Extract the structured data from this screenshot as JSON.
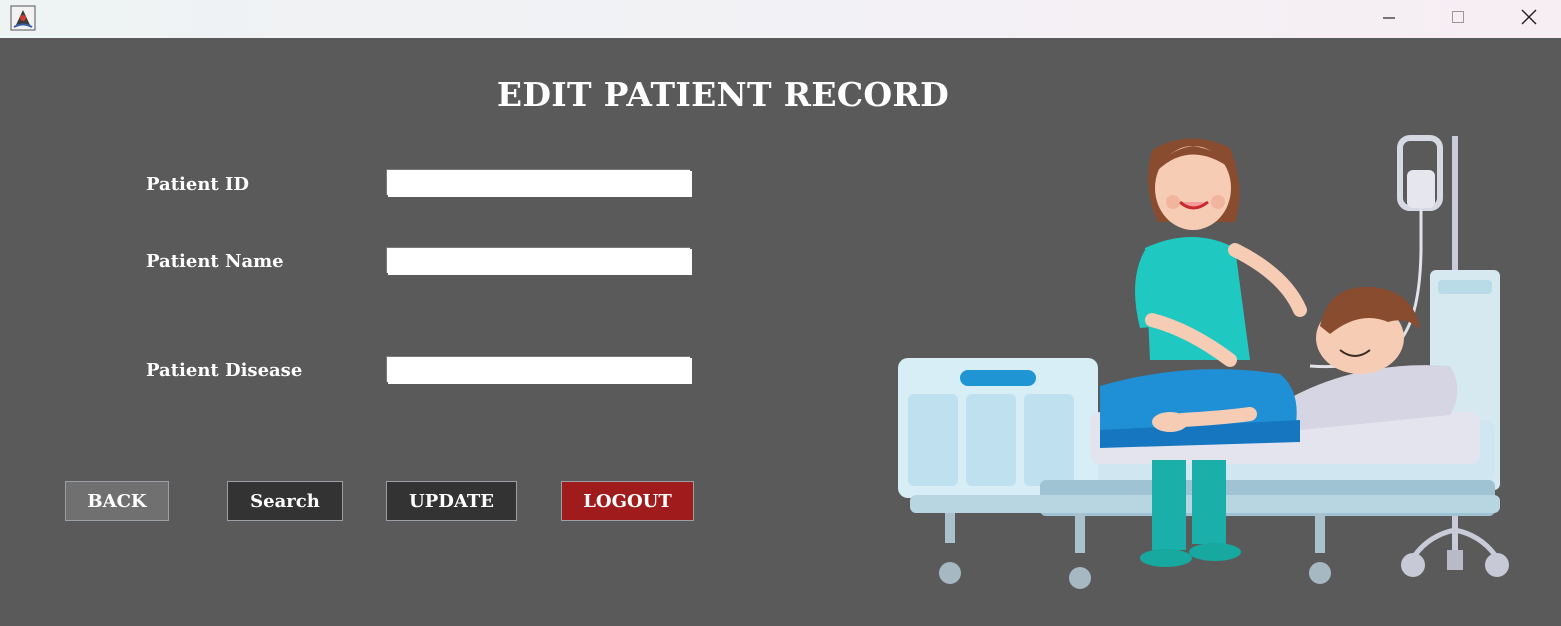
{
  "window": {
    "app_icon": "java-app-icon",
    "controls": [
      "minimize-icon",
      "maximize-icon",
      "close-icon"
    ]
  },
  "page": {
    "title": "EDIT PATIENT RECORD"
  },
  "form": {
    "fields": [
      {
        "label": "Patient ID",
        "value": "",
        "placeholder": ""
      },
      {
        "label": "Patient Name",
        "value": "",
        "placeholder": ""
      },
      {
        "label": "Patient Disease",
        "value": "",
        "placeholder": ""
      }
    ]
  },
  "buttons": {
    "back": "BACK",
    "search": "Search",
    "update": "UPDATE",
    "logout": "LOGOUT"
  },
  "colors": {
    "background": "#5a5a5a",
    "back_button": "#707070",
    "dark_button": "#333333",
    "logout_button": "#a01c1c",
    "title_text": "#ffffff"
  },
  "illustration": {
    "subject": "nurse-caring-for-patient-in-hospital-bed"
  }
}
